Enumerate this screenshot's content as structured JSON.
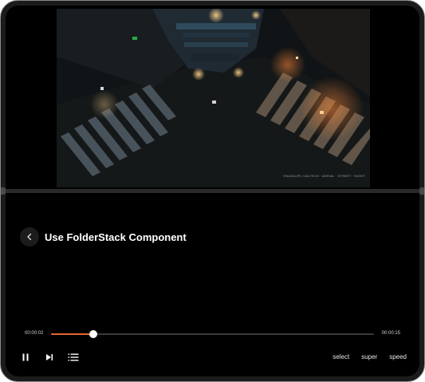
{
  "app": {
    "title": "Use FolderStack Component"
  },
  "player": {
    "current_time": "00:00:02",
    "total_time": "00:00:15",
    "progress_fraction": 0.13,
    "accent_color": "#e5652f",
    "video_watermark": "©NASA/JPL·CALTECH · AERIAL · STREET · NIGHT"
  },
  "controls": {
    "left": [
      {
        "name": "pause-button",
        "icon": "pause-icon"
      },
      {
        "name": "next-button",
        "icon": "next-icon"
      },
      {
        "name": "playlist-button",
        "icon": "list-icon"
      }
    ],
    "right": [
      "select",
      "super",
      "speed"
    ]
  }
}
